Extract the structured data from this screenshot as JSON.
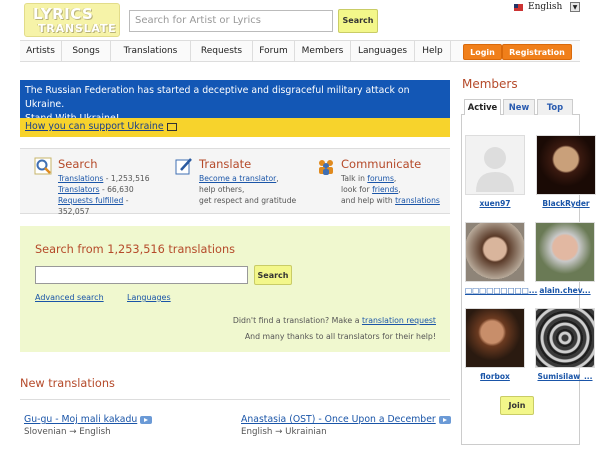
{
  "header": {
    "logo_line1": "LYRICS",
    "logo_line2": "TRANSLATE",
    "search_placeholder": "Search for Artist or Lyrics",
    "search_button": "Search",
    "language": "English"
  },
  "nav": {
    "items": [
      "Artists",
      "Songs",
      "Translations",
      "Requests",
      "Forum",
      "Members",
      "Languages",
      "Help"
    ],
    "login": "Login",
    "registration": "Registration"
  },
  "banner": {
    "text_line1": "The Russian Federation has started a deceptive and disgraceful military attack on Ukraine.",
    "text_line2": "Stand With Ukraine!",
    "support_link": "How you can support Ukraine"
  },
  "features": {
    "search": {
      "title": "Search",
      "translations_link": "Translations",
      "translations_count": " - 1,253,516",
      "translators_link": "Translators",
      "translators_count": " - 66,630",
      "requests_link": "Requests fulfilled",
      "requests_count": " -",
      "requests_count2": "352,057"
    },
    "translate": {
      "title": "Translate",
      "link": "Become a translator",
      "after_link": ",",
      "line2": "help others,",
      "line3": "get respect and gratitude"
    },
    "communicate": {
      "title": "Communicate",
      "talk": "Talk in ",
      "forums": "forums",
      "comma": ",",
      "look": "look for ",
      "friends": "friends",
      "comma2": ",",
      "help": "and help with ",
      "translations": "translations"
    }
  },
  "search_block": {
    "title": "Search from 1,253,516 translations",
    "button": "Search",
    "advanced": "Advanced search",
    "languages": "Languages",
    "note1_text": "Didn't find a translation? Make a ",
    "note1_link": "translation request",
    "note2": "And many thanks to all translators for their help!"
  },
  "new_translations": {
    "title": "New translations",
    "items": [
      {
        "song": "Gu-gu - Moj mali kakadu",
        "langs": "Slovenian → English"
      },
      {
        "song": "Anastasia (OST) - Once Upon a December",
        "langs": "English → Ukrainian"
      }
    ]
  },
  "sidebar": {
    "title": "Members",
    "tabs": [
      "Active",
      "New",
      "Top"
    ],
    "members": [
      "xuen97",
      "BlackRyder",
      "□□□□□□□□□...",
      "alain.chev...",
      "florbox",
      "Sumisilaw_..."
    ],
    "join": "Join"
  },
  "colors": {
    "blue_banner": "#1357b5",
    "yellow_banner": "#f7d32c",
    "accent_orange": "#f07f1a",
    "heading": "#b54a2a",
    "search_bg": "#f0f8cf"
  }
}
